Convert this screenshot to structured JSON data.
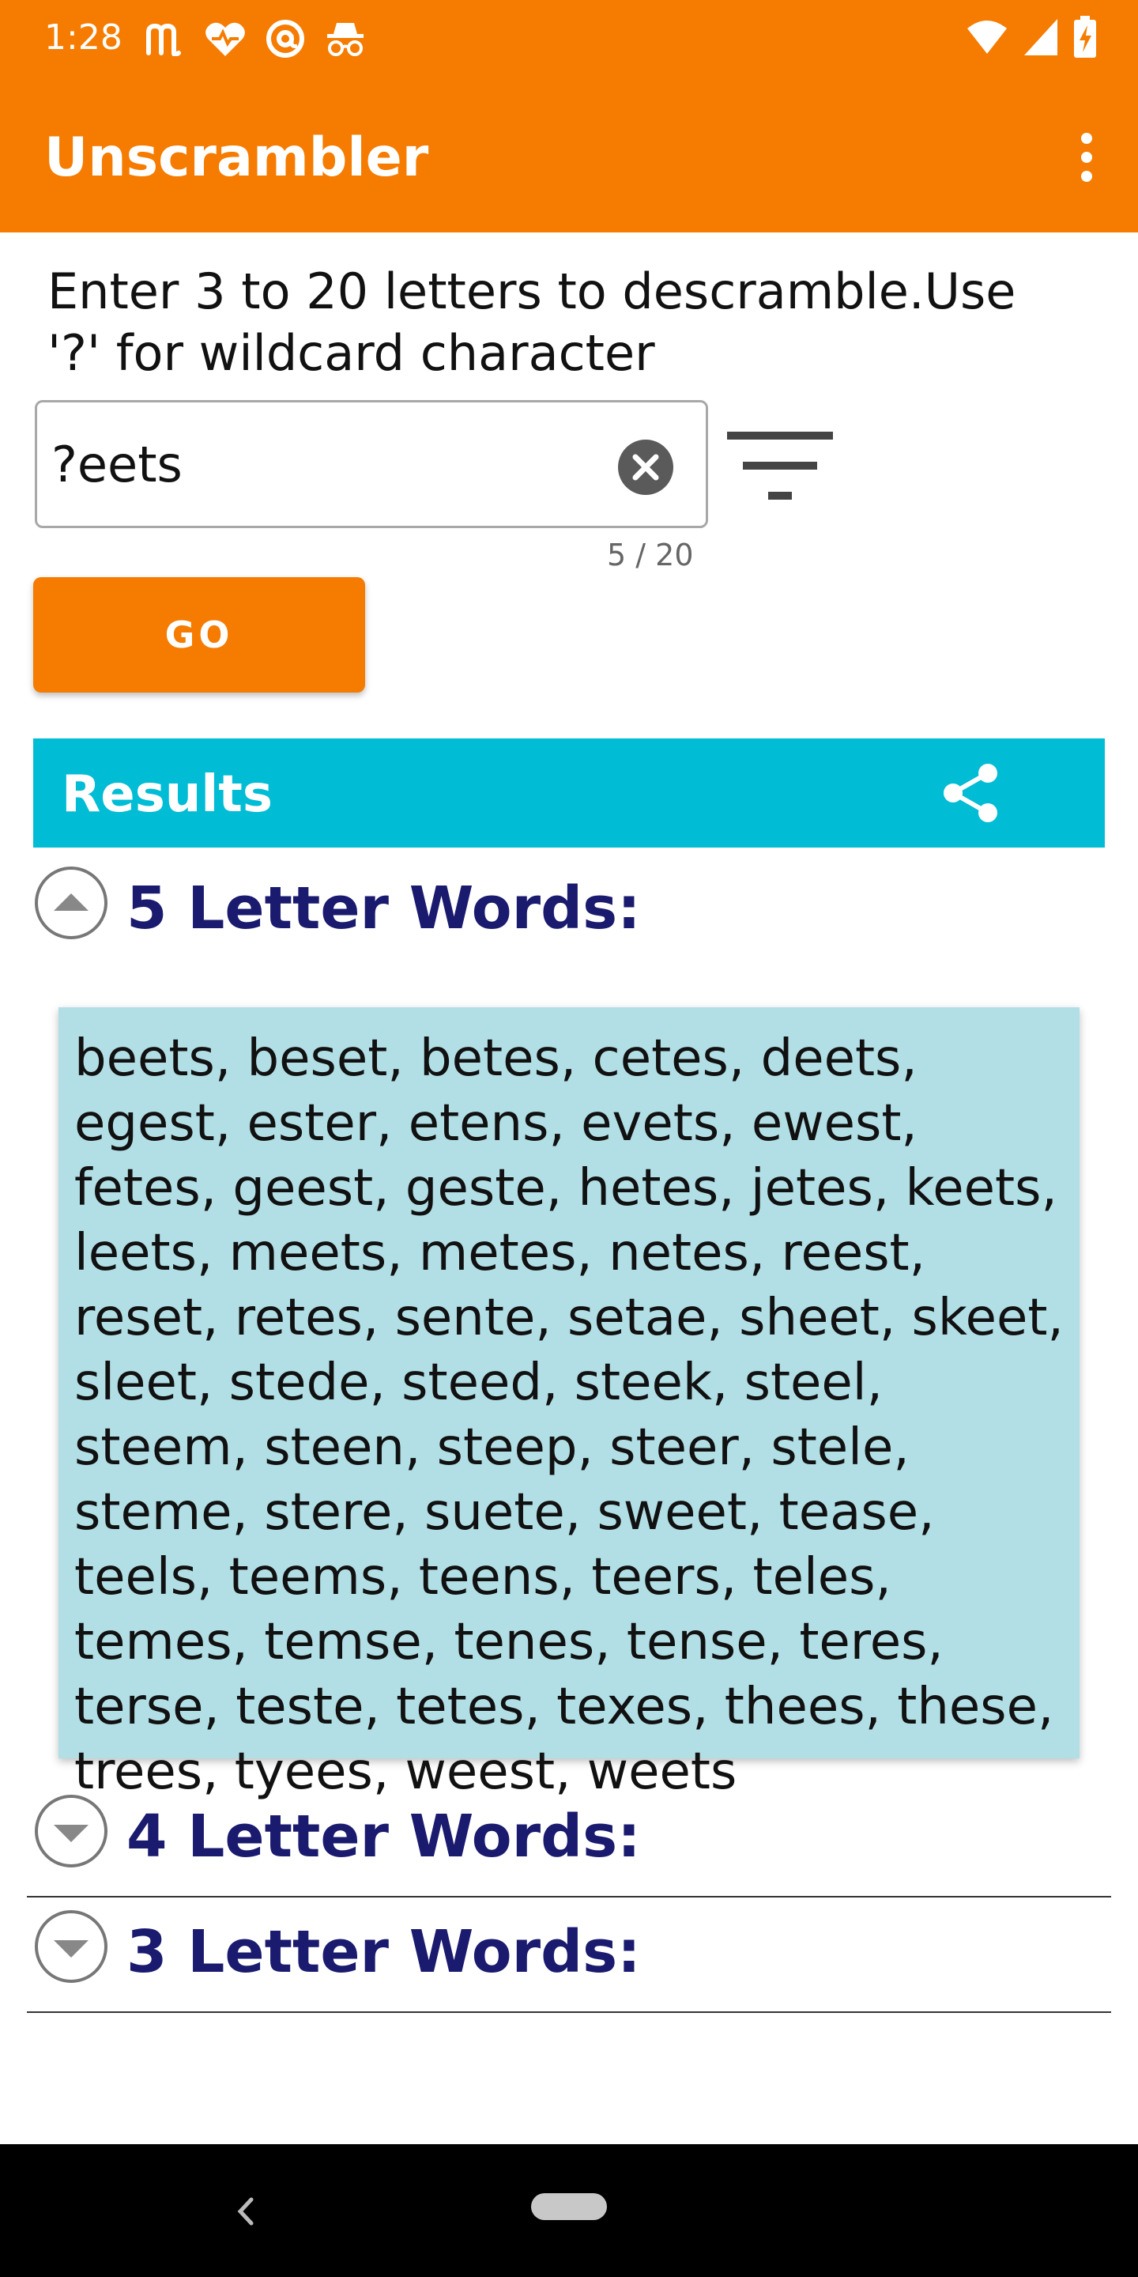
{
  "status_bar": {
    "time": "1:28",
    "left_icons": [
      "m-notification-icon",
      "heart-icon",
      "at-sign-icon",
      "incognito-icon"
    ],
    "right_icons": [
      "wifi-icon",
      "signal-icon",
      "battery-charging-icon"
    ]
  },
  "app_bar": {
    "title": "Unscrambler",
    "menu_icon": "more-vertical-icon"
  },
  "search": {
    "instructions": "Enter 3 to 20 letters to descramble.Use '?' for wildcard character",
    "input_value": "?eets",
    "char_count": "5 / 20",
    "go_label": "GO"
  },
  "results": {
    "title": "Results",
    "share_icon": "share-icon",
    "groups": [
      {
        "title": "5 Letter Words:",
        "expanded": true,
        "words": "beets, beset, betes, cetes, deets, egest, ester, etens, evets, ewest, fetes, geest, geste, hetes, jetes, keets, leets, meets, metes, netes, reest, reset, retes, sente, setae, sheet, skeet, sleet, stede, steed, steek, steel, steem, steen, steep, steer, stele, steme, stere, suete, sweet, tease, teels, teems, teens, teers, teles, temes, temse, tenes, tense, teres, terse, teste, tetes, texes, thees, these, trees, tyees, weest, weets"
      },
      {
        "title": "4 Letter Words:",
        "expanded": false
      },
      {
        "title": "3 Letter Words:",
        "expanded": false
      }
    ]
  },
  "colors": {
    "app_bar": "#f57c00",
    "results_bar": "#00bcd4",
    "words_box": "#b2dfe6",
    "group_title": "#1a1a6e"
  }
}
